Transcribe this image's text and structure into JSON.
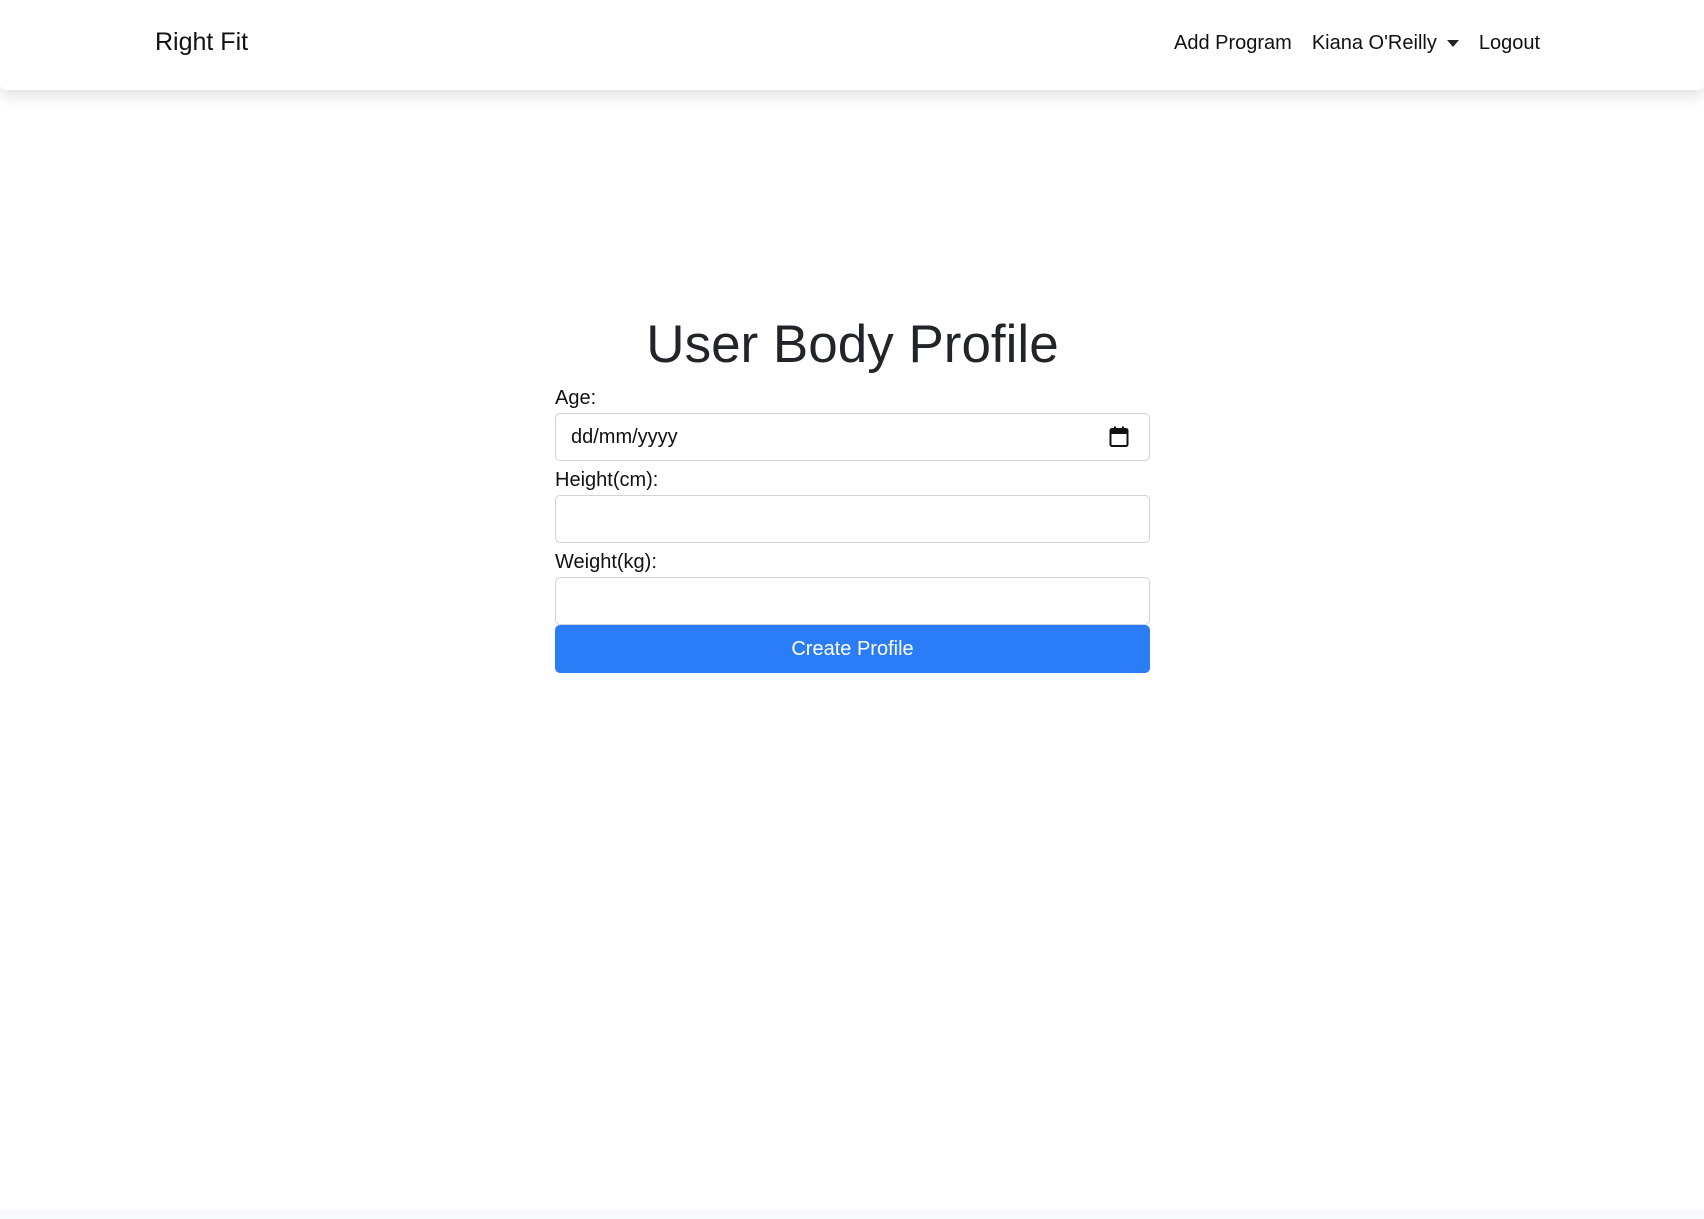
{
  "navbar": {
    "brand": "Right Fit",
    "links": {
      "add_program": "Add Program",
      "user_name": "Kiana O'Reilly",
      "logout": "Logout"
    }
  },
  "form": {
    "title": "User Body Profile",
    "age_label": "Age:",
    "age_value": "dd/mm/yyyy",
    "height_label": "Height(cm):",
    "height_value": "",
    "weight_label": "Weight(kg):",
    "weight_value": "",
    "submit_label": "Create Profile"
  },
  "colors": {
    "primary": "#2a7cf7",
    "text": "#212529",
    "border": "#ced4da"
  },
  "icons": {
    "calendar": "calendar-icon",
    "dropdown": "chevron-down-icon"
  }
}
